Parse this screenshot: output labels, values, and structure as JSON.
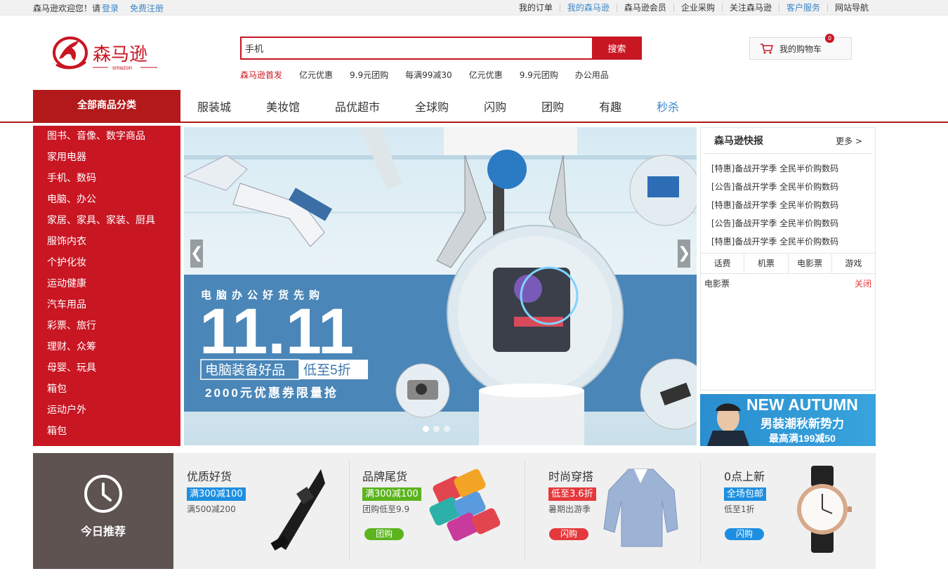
{
  "topbar": {
    "welcome": "森马逊欢迎您！请",
    "login": "登录",
    "register": "免费注册",
    "links": [
      "我的订单",
      "我的森马逊",
      "森马逊会员",
      "企业采购",
      "关注森马逊",
      "客户服务",
      "网站导航"
    ]
  },
  "logo": {
    "text": "森马逊",
    "sub": "smazon"
  },
  "search": {
    "value": "手机",
    "button": "搜索"
  },
  "hotwords": [
    "森马逊首发",
    "亿元优惠",
    "9.9元团购",
    "每满99减30",
    "亿元优惠",
    "9.9元团购",
    "办公用品"
  ],
  "cart": {
    "label": "我的购物车",
    "count": "0"
  },
  "nav": {
    "all_label": "全部商品分类",
    "items": [
      "服装城",
      "美妆馆",
      "品优超市",
      "全球购",
      "闪购",
      "团购",
      "有趣",
      "秒杀"
    ]
  },
  "categories": [
    "图书、音像、数字商品",
    "家用电器",
    "手机、数码",
    "电脑、办公",
    "家居、家具、家装、厨具",
    "服饰内衣",
    "个护化妆",
    "运动健康",
    "汽车用品",
    "彩票、旅行",
    "理财、众筹",
    "母婴、玩具",
    "箱包",
    "运动户外",
    "箱包"
  ],
  "banner": {
    "headline_small": "电脑办公好货先购",
    "headline_big": "11.11",
    "tag_left": "电脑装备好品",
    "tag_right": "低至5折",
    "coupon": "2000元优惠券限量抢",
    "arrow_left": "❮",
    "arrow_right": "❯"
  },
  "news": {
    "title": "森马逊快报",
    "more": "更多 >",
    "items": [
      "[特惠]备战开学季 全民半价购数码",
      "[公告]备战开学季 全民半价购数码",
      "[特惠]备战开学季 全民半价购数码",
      "[公告]备战开学季 全民半价购数码",
      "[特惠]备战开学季 全民半价购数码"
    ],
    "tabs": [
      "话费",
      "机票",
      "电影票",
      "游戏"
    ],
    "panel_label": "电影票",
    "panel_close": "关闭"
  },
  "ad": {
    "line1": "NEW AUTUMN",
    "line2": "男装潮秋新势力",
    "line3": "最高满199减50"
  },
  "recommend": {
    "label": "今日推荐",
    "cards": [
      {
        "title": "优质好货",
        "badge": "满300减100",
        "badge_color": "#1e8fe0",
        "sub": "满500减200",
        "pill": "",
        "pill_color": ""
      },
      {
        "title": "品牌尾货",
        "badge": "满300减100",
        "badge_color": "#5bb41e",
        "sub": "团购低至9.9",
        "pill": "团购",
        "pill_color": "#5bb41e"
      },
      {
        "title": "时尚穿搭",
        "badge": "低至3.6折",
        "badge_color": "#e4393c",
        "sub": "暑期出游季",
        "pill": "闪购",
        "pill_color": "#e4393c"
      },
      {
        "title": "0点上新",
        "badge": "全场包邮",
        "badge_color": "#1e8fe0",
        "sub": "低至1折",
        "pill": "闪购",
        "pill_color": "#1e8fe0"
      }
    ]
  },
  "colors": {
    "brand_red": "#c81623",
    "nav_red": "#b1191a",
    "link_blue": "#3b87c8"
  }
}
